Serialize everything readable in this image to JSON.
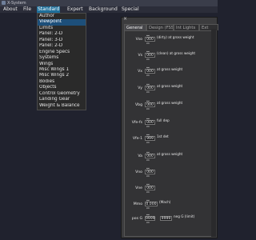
{
  "window": {
    "title": "X-System"
  },
  "menubar": {
    "items": [
      "About",
      "File",
      "Standard",
      "Expert",
      "Background",
      "Special"
    ]
  },
  "dropdown": {
    "selected": "Viewpoint",
    "items": [
      "Author",
      "Viewpoint",
      "Limits",
      "Panel: 2-D",
      "Panel: 3-D",
      "Panel: 2-D",
      "Engine Specs",
      "Systems",
      "Wings",
      "Misc Wings 1",
      "Misc Wings 2",
      "Bodies",
      "Objects",
      "Control Geometry",
      "Landing Gear",
      "Weight & Balance"
    ]
  },
  "panel": {
    "close": "×",
    "tabs": [
      "General",
      "Design (FSS)",
      "Int Lights",
      "Ext"
    ],
    "active_tab": "General",
    "rows": [
      {
        "label": "Vso",
        "value": "000",
        "desc": "(dirty) at gross weight"
      },
      {
        "label": "Vs",
        "value": "000",
        "desc": "(clean) at gross weight"
      },
      {
        "label": "Vx",
        "value": "000",
        "desc": "at gross weight"
      },
      {
        "label": "Vy",
        "value": "000",
        "desc": "at gross weight"
      },
      {
        "label": "Vbg",
        "value": "000",
        "desc": "at gross weight"
      },
      {
        "label": "Vfe-fs",
        "value": "000",
        "desc": "full dep"
      },
      {
        "label": "Vfe-1",
        "value": "999",
        "desc": "1st det"
      },
      {
        "label": "Va",
        "value": "000",
        "desc": "at gross weight"
      },
      {
        "label": "Vno",
        "value": "000",
        "desc": ""
      },
      {
        "label": "Vne",
        "value": "000",
        "desc": ""
      },
      {
        "label": "Mmo",
        "value": "0.000",
        "desc": "(Mach)"
      },
      {
        "label": "pos G",
        "value": "9999",
        "value2": "9999",
        "desc": "neg G (limit)"
      }
    ]
  },
  "colors": {
    "accent": "#1f6f9a",
    "selection": "#1d4f7a",
    "panel_bg": "#3c3c3e",
    "background": "#20222e"
  }
}
